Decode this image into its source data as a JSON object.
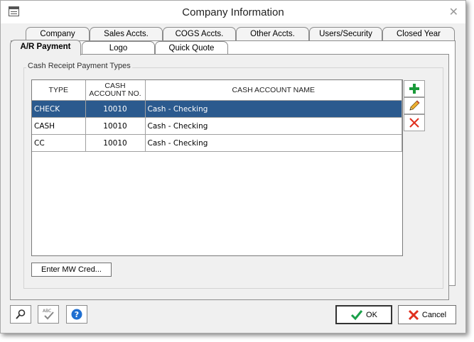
{
  "window": {
    "title": "Company Information"
  },
  "tabs_row1": [
    {
      "label": "Company"
    },
    {
      "label": "Sales Accts."
    },
    {
      "label": "COGS Accts."
    },
    {
      "label": "Other Accts."
    },
    {
      "label": "Users/Security"
    },
    {
      "label": "Closed Year"
    }
  ],
  "tabs_row2": [
    {
      "label": "A/R Payment",
      "active": true
    },
    {
      "label": "Logo"
    },
    {
      "label": "Quick Quote"
    }
  ],
  "group": {
    "label": "Cash Receipt Payment Types"
  },
  "grid": {
    "headers": {
      "type": "TYPE",
      "cash_account_no_1": "CASH",
      "cash_account_no_2": "ACCOUNT NO.",
      "cash_account_name": "CASH ACCOUNT NAME"
    },
    "rows": [
      {
        "type": "CHECK",
        "account_no": "10010",
        "account_name": "Cash - Checking",
        "selected": true
      },
      {
        "type": "CASH",
        "account_no": "10010",
        "account_name": "Cash - Checking"
      },
      {
        "type": "CC",
        "account_no": "10010",
        "account_name": "Cash - Checking"
      }
    ]
  },
  "buttons": {
    "enter_mw": "Enter MW Cred...",
    "ok": "OK",
    "cancel": "Cancel"
  },
  "colors": {
    "selection": "#2b5a8e",
    "add_icon": "#1a9a3a",
    "delete_icon": "#e0301e",
    "help_icon": "#1f6fd1"
  }
}
